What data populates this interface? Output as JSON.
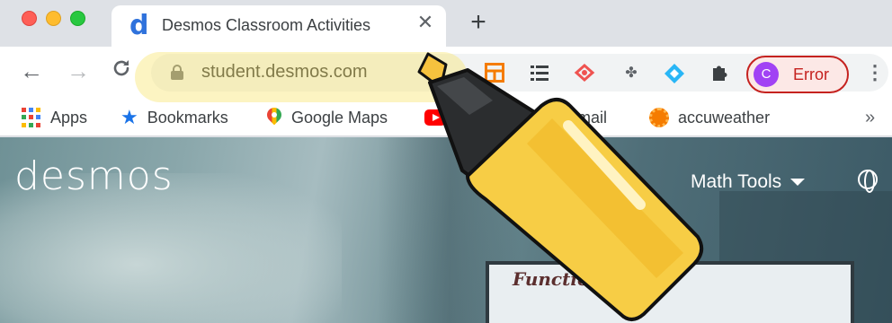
{
  "tab": {
    "favicon": "d",
    "title": "Desmos Classroom Activities",
    "close": "✕"
  },
  "new_tab": "+",
  "toolbar": {
    "back": "←",
    "forward": "→",
    "reload": "C",
    "url": "student.desmos.com",
    "profile_initial": "C",
    "profile_status": "Error",
    "menu": "⋮"
  },
  "bookmarks": [
    {
      "label": "Apps",
      "icon": "apps-grid-icon"
    },
    {
      "label": "Bookmarks",
      "icon": "star-icon"
    },
    {
      "label": "Google Maps",
      "icon": "maps-pin-icon"
    },
    {
      "label": "gmail",
      "icon": "youtube-icon"
    },
    {
      "label": "accuweather",
      "icon": "sun-icon"
    }
  ],
  "bookmarks_overflow": "»",
  "page": {
    "logo": "desmos",
    "math_tools": "Math Tools",
    "function_text": "Function"
  },
  "colors": {
    "accent": "#2f72dc",
    "error": "#c5221f",
    "highlighter_yellow": "#f7cd45",
    "highlighter_cap": "#2b2d2f"
  }
}
